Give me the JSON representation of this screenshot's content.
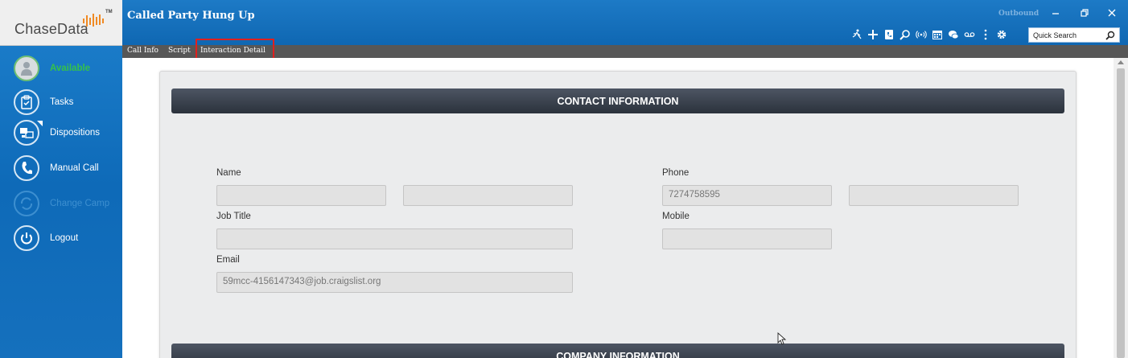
{
  "app": {
    "logo_text": "ChaseData",
    "logo_tm": "TM",
    "window_title": "Called Party Hung Up",
    "direction": "Outbound",
    "window_controls": [
      "minimize-icon",
      "restore-icon",
      "close-icon"
    ]
  },
  "sidebar": {
    "items": [
      {
        "label": "Available",
        "icon": "user-icon",
        "state": "active",
        "color": "#35c24a"
      },
      {
        "label": "Tasks",
        "icon": "clipboard-icon"
      },
      {
        "label": "Dispositions",
        "icon": "dispositions-icon"
      },
      {
        "label": "Manual Call",
        "icon": "phone-icon"
      },
      {
        "label": "Change Camp",
        "icon": "refresh-icon",
        "state": "disabled"
      },
      {
        "label": "Logout",
        "icon": "power-icon"
      }
    ]
  },
  "toolbar": {
    "icons": [
      "walk-icon",
      "plus-icon",
      "phone-book-icon",
      "search-icon",
      "broadcast-icon",
      "calendar-icon",
      "chat-icon",
      "voicemail-icon",
      "more-vertical-icon",
      "gear-icon"
    ],
    "quick_search_placeholder": "Quick Search"
  },
  "tabs": [
    {
      "label": "Call Info"
    },
    {
      "label": "Script"
    },
    {
      "label": "Interaction Detail",
      "selected": true,
      "highlight_color": "#e0201e"
    }
  ],
  "contact": {
    "section_title": "CONTACT INFORMATION",
    "name_label": "Name",
    "first_name": "",
    "last_name": "",
    "job_title_label": "Job Title",
    "job_title": "",
    "email_label": "Email",
    "email": "59mcc-4156147343@job.craigslist.org",
    "phone_label": "Phone",
    "phone": "7274758595",
    "phone_ext": "",
    "mobile_label": "Mobile",
    "mobile": ""
  },
  "company": {
    "section_title": "COMPANY INFORMATION"
  },
  "colors": {
    "header_blue": "#1570bd",
    "tab_strip": "#575757",
    "section_bar": "#2b323c"
  }
}
